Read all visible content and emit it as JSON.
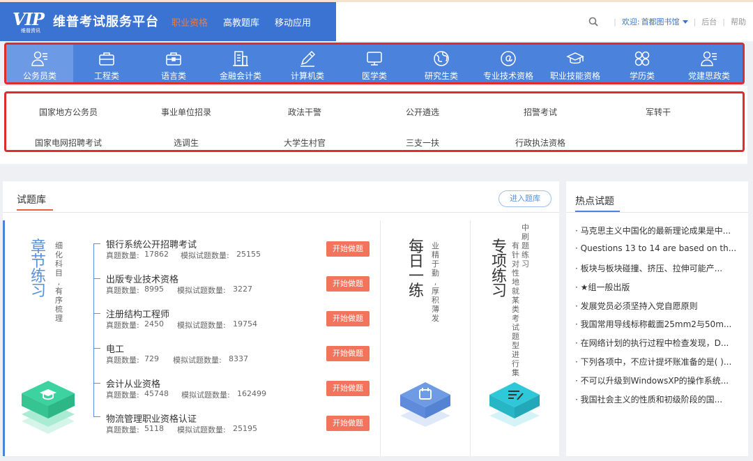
{
  "header": {
    "logo_text": "VIP",
    "logo_sub": "维普资讯",
    "site_title": "维普考试服务平台",
    "nav": [
      "职业资格",
      "高教题库",
      "移动应用"
    ],
    "welcome_label": "欢迎:",
    "library": "首都图书馆",
    "backend": "后台",
    "help": "帮助"
  },
  "categories": [
    {
      "label": "公务员类",
      "icon": "civil-servant-icon"
    },
    {
      "label": "工程类",
      "icon": "engineering-briefcase-icon"
    },
    {
      "label": "语言类",
      "icon": "language-briefcase-icon"
    },
    {
      "label": "金融会计类",
      "icon": "building-icon"
    },
    {
      "label": "计算机类",
      "icon": "pencil-icon"
    },
    {
      "label": "医学类",
      "icon": "monitor-icon"
    },
    {
      "label": "研究生类",
      "icon": "globe-icon"
    },
    {
      "label": "专业技术资格",
      "icon": "at-icon"
    },
    {
      "label": "职业技能资格",
      "icon": "graduation-cap-icon"
    },
    {
      "label": "学历类",
      "icon": "grid-icon"
    },
    {
      "label": "党建思政类",
      "icon": "party-user-icon"
    }
  ],
  "subcategories": [
    "国家地方公务员",
    "事业单位招录",
    "政法干警",
    "公开遴选",
    "招警考试",
    "军转干",
    "国家电网招聘考试",
    "选调生",
    "大学生村官",
    "三支一扶",
    "行政执法资格"
  ],
  "bank": {
    "title": "试题库",
    "enter_label": "进入题库",
    "chapter": {
      "big": [
        "章",
        "节",
        "练",
        "习"
      ],
      "small": [
        "细",
        "化",
        "科",
        "目",
        ",",
        "有",
        "序",
        "梳",
        "理"
      ]
    },
    "real_label": "真题数量:",
    "mock_label": "模拟试题数量:",
    "start_label": "开始做题",
    "exams": [
      {
        "name": "银行系统公开招聘考试",
        "real": "17862",
        "mock": "25155"
      },
      {
        "name": "出版专业技术资格",
        "real": "8995",
        "mock": "3227"
      },
      {
        "name": "注册结构工程师",
        "real": "2450",
        "mock": "19754"
      },
      {
        "name": "电工",
        "real": "729",
        "mock": "8337"
      },
      {
        "name": "会计从业资格",
        "real": "45748",
        "mock": "162499"
      },
      {
        "name": "物流管理职业资格认证",
        "real": "5118",
        "mock": "25195"
      }
    ],
    "daily": {
      "big": [
        "每",
        "日",
        "一",
        "练"
      ],
      "small": [
        "业",
        "精",
        "于",
        "勤",
        ",",
        "厚",
        "积",
        "薄",
        "发"
      ]
    },
    "special": {
      "big": [
        "专",
        "项",
        "练",
        "习"
      ],
      "small_col1": [
        "有",
        "针",
        "对",
        "性",
        "地",
        "就",
        "某",
        "类",
        "考",
        "试",
        "题",
        "型",
        "进",
        "行",
        "集"
      ],
      "small_col2": [
        "中",
        "刷",
        "题",
        "练",
        "习"
      ]
    }
  },
  "hot": {
    "title": "热点试题",
    "items": [
      "马克思主义中国化的最新理论成果是中...",
      "Questions 13 to 14 are based on th...",
      "板块与板块碰撞、挤压、拉伸可能产...",
      "★组一般出版",
      "发展党员必须坚持入党自愿原则",
      "我国常用导线标称截面25mm2与50m...",
      "在网络计划的执行过程中检查发现，D...",
      "下列各项中，不应计提坏账准备的是( )...",
      "不可以升级到WindowsXP的操作系统...",
      "我国社会主义的性质和初级阶段的国..."
    ]
  },
  "colors": {
    "brand_blue": "#3a73d2",
    "nav_blue": "#4a82dc",
    "highlight_red": "#e02b2b",
    "orange": "#f2745c",
    "green": "#3dd3a0",
    "cyan": "#2ec8d8"
  }
}
